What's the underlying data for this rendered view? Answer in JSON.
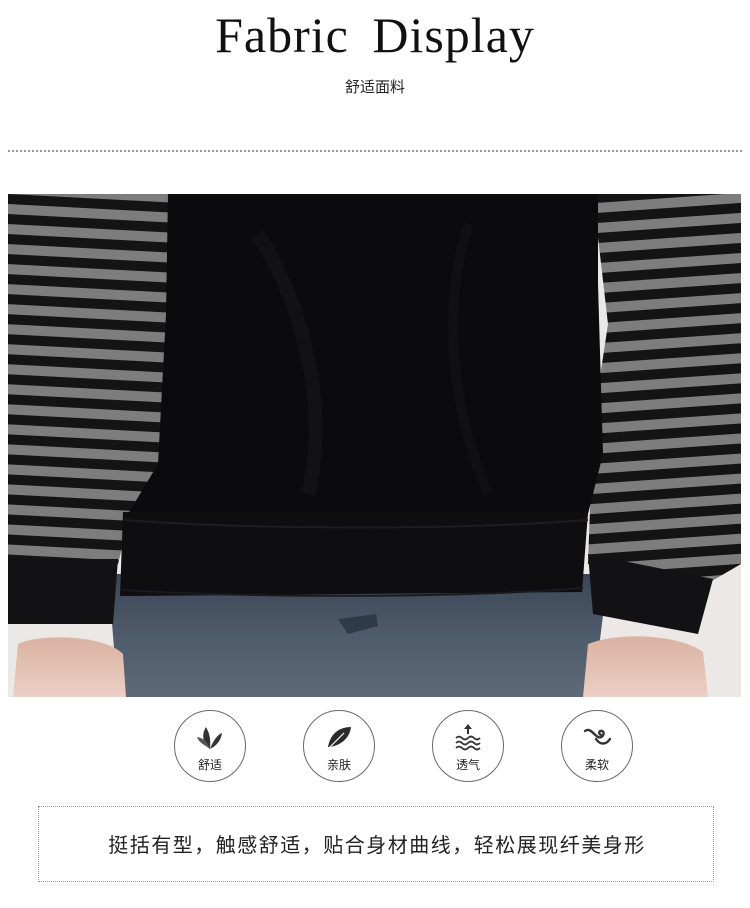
{
  "header": {
    "title": "Fabric  Display",
    "subtitle": "舒适面料"
  },
  "features": [
    {
      "label": "舒适",
      "icon": "leaf-icon"
    },
    {
      "label": "亲肤",
      "icon": "feather-icon"
    },
    {
      "label": "透气",
      "icon": "breathable-waves-icon"
    },
    {
      "label": "柔软",
      "icon": "soft-swirl-icon"
    }
  ],
  "description": "挺括有型，触感舒适，贴合身材曲线，轻松展现纤美身形",
  "colors": {
    "garment": "#0b0b0d",
    "stripe_gray": "#7d7d7d",
    "denim": "#3e4d5e",
    "skin": "#e3c1b1"
  }
}
